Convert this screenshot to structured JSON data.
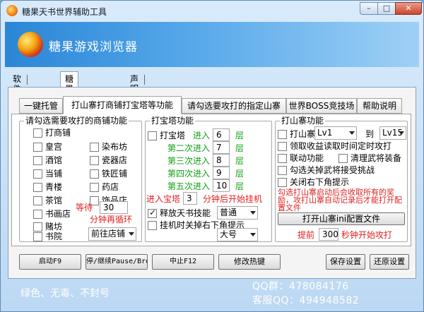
{
  "window": {
    "title": "糖果天书世界辅助工具",
    "min": "–",
    "max": "□",
    "close": "✕"
  },
  "banner": {
    "title": "糖果游戏浏览器"
  },
  "outer_tabs": [
    {
      "label": "软件说明"
    },
    {
      "label": "糖果天书世界"
    },
    {
      "label": "声明"
    }
  ],
  "inner_tabs": [
    {
      "label": "一键托管"
    },
    {
      "label": "打山寨打商铺打宝塔等功能"
    },
    {
      "label": "请勾选要攻打的指定山寨"
    },
    {
      "label": "世界BOSS竞技场"
    },
    {
      "label": "帮助说明"
    }
  ],
  "shops": {
    "title": "请勾选需要攻打的商铺功能",
    "items": [
      {
        "label": "打商铺",
        "checked": false
      },
      {
        "label": "皇宫",
        "checked": false
      },
      {
        "label": "染布坊",
        "checked": false
      },
      {
        "label": "酒馆",
        "checked": false
      },
      {
        "label": "瓷器店",
        "checked": false
      },
      {
        "label": "当铺",
        "checked": false
      },
      {
        "label": "铁匠铺",
        "checked": false
      },
      {
        "label": "青楼",
        "checked": false
      },
      {
        "label": "药店",
        "checked": false
      },
      {
        "label": "茶馆",
        "checked": false
      },
      {
        "label": "饰品店",
        "checked": false
      },
      {
        "label": "书画店",
        "checked": false
      },
      {
        "label": "赌坊",
        "checked": false
      },
      {
        "label": "书院",
        "checked": false
      }
    ],
    "wait_label": "等待",
    "wait_value": "30",
    "cycle_label": "分钟再循环",
    "goto_select": "前往店铺"
  },
  "tower": {
    "title": "打宝塔功能",
    "check_label": "打宝塔",
    "rows": [
      {
        "label": "进入",
        "value": "6",
        "unit": "层"
      },
      {
        "label": "第二次进入",
        "value": "7",
        "unit": "层"
      },
      {
        "label": "第三次进入",
        "value": "8",
        "unit": "层"
      },
      {
        "label": "第四次进入",
        "value": "9",
        "unit": "层"
      },
      {
        "label": "第五次进入",
        "value": "10",
        "unit": "层"
      }
    ],
    "enter_label": "进入宝塔",
    "enter_value": "3",
    "enter_suffix": "分钟后开始挂机",
    "release_label": "释放天书技能",
    "release_checked": true,
    "release_select": "普通",
    "close_label": "挂机时关掉右下角提示",
    "close_checked": false,
    "size_select": "大号"
  },
  "fort": {
    "title": "打山寨功能",
    "attack_label": "打山寨",
    "from_select": "Lv1",
    "to_label": "到",
    "to_select": "Lv15",
    "opts": [
      {
        "label": "领取收益读取时间定时攻打",
        "checked": false
      },
      {
        "label": "联动功能",
        "checked": false
      },
      {
        "label": "清理武将装备",
        "checked": false
      },
      {
        "label": "勾选关掉武将接受挑战",
        "checked": false
      },
      {
        "label": "关闭右下角提示",
        "checked": false
      }
    ],
    "notice": "勾选打山寨启动后会收取所有的奖励，攻打山寨自动记录后才能打开配置文件",
    "open_button": "打开山寨ini配置文件",
    "ahead_label": "提前",
    "ahead_value": "300",
    "ahead_suffix": "秒钟开始攻打"
  },
  "actions": {
    "start": "启动F9",
    "pause": "停/继续Pause/Break",
    "stop": "中止F12",
    "hotkey": "修改热键",
    "save": "保存设置",
    "restore": "还原设置"
  },
  "footer": {
    "slogan": "绿色、无毒、不封号",
    "qq_group": "QQ群：478084176",
    "qq_service": "客服QQ：494948582"
  }
}
